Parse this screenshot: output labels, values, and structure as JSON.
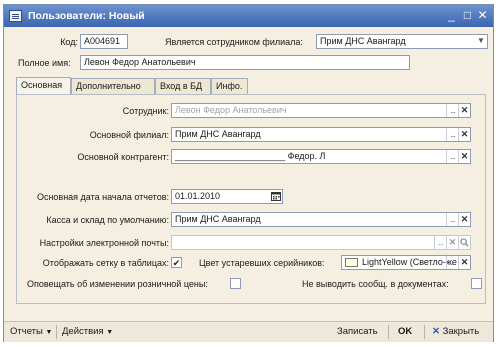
{
  "window": {
    "title": "Пользователи: Новый",
    "controls": {
      "minimize": "_",
      "maximize": "□",
      "close": "✕"
    }
  },
  "header": {
    "code_label": "Код:",
    "code_value": "A004691",
    "branch_employee_label": "Является сотрудником филиала:",
    "branch_employee_value": "Прим ДНС  Авангард",
    "fullname_label": "Полное имя:",
    "fullname_value": "Левон Федор Анатольевич"
  },
  "tabs": [
    {
      "label": "Основная",
      "active": true
    },
    {
      "label": "Дополнительно",
      "active": false
    },
    {
      "label": "Вход в БД",
      "active": false
    },
    {
      "label": "Инфо.",
      "active": false
    }
  ],
  "form": {
    "employee_label": "Сотрудник:",
    "employee_value": "Левон Федор Анатольевич",
    "main_branch_label": "Основной филиал:",
    "main_branch_value": "Прим ДНС  Авангард",
    "main_contractor_label": "Основной контрагент:",
    "main_contractor_value": "______________________ Федор. Л",
    "report_start_label": "Основная дата начала отчетов:",
    "report_start_value": "01.01.2010",
    "cash_warehouse_label": "Касса и склад по умолчанию:",
    "cash_warehouse_value": "Прим ДНС  Авангард",
    "email_settings_label": "Настройки электронной почты:",
    "email_settings_value": "",
    "show_grid_label": "Отображать сетку в таблицах:",
    "show_grid_checked": true,
    "outdated_color_label": "Цвет устаревших серийников:",
    "outdated_color_value": "LightYellow (Светло-же",
    "outdated_color_swatch": "#ffffe0",
    "notify_retail_label": "Оповещать об изменении розничной цены:",
    "notify_retail_checked": false,
    "no_messages_label": "Не выводить сообщ. в документах:",
    "no_messages_checked": false
  },
  "bottom": {
    "reports_label": "Отчеты",
    "actions_label": "Действия",
    "save_label": "Записать",
    "ok_label": "OK",
    "close_label": "Закрыть"
  },
  "colors": {
    "title_bar": "#4a74bf",
    "window_bg": "#f4efe0",
    "close_x": "#2d5aa8"
  },
  "icons": {
    "title": "document-icon",
    "dropdown": "chevron-down-icon",
    "choose": "ellipsis-icon",
    "clear": "clear-x-icon",
    "calendar": "calendar-icon",
    "search": "magnifier-icon",
    "menu_arrow": "triangle-down-icon"
  }
}
